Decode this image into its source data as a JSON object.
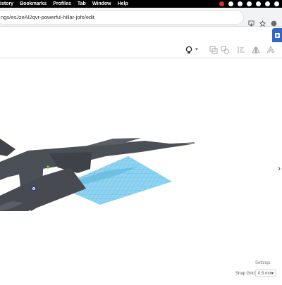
{
  "menubar": {
    "items": [
      "istory",
      "Bookmarks",
      "Profiles",
      "Tab",
      "Window",
      "Help"
    ]
  },
  "browser": {
    "url": "ngs/esJzeAl2qvr-powerful-hillar-jofo/edit"
  },
  "toolbar": {
    "lightbulb_icon": "lightbulb-icon",
    "chevron": "▾"
  },
  "canvas": {
    "grid_color": "#5bc3ee",
    "model_color": "#4b4f56"
  },
  "footer": {
    "settings_label": "Settings",
    "snap_grid_label": "Snap Grid",
    "snap_grid_value": "0.5 mm"
  },
  "icons": {
    "left_stub": "‹",
    "right_arrow": "›"
  }
}
